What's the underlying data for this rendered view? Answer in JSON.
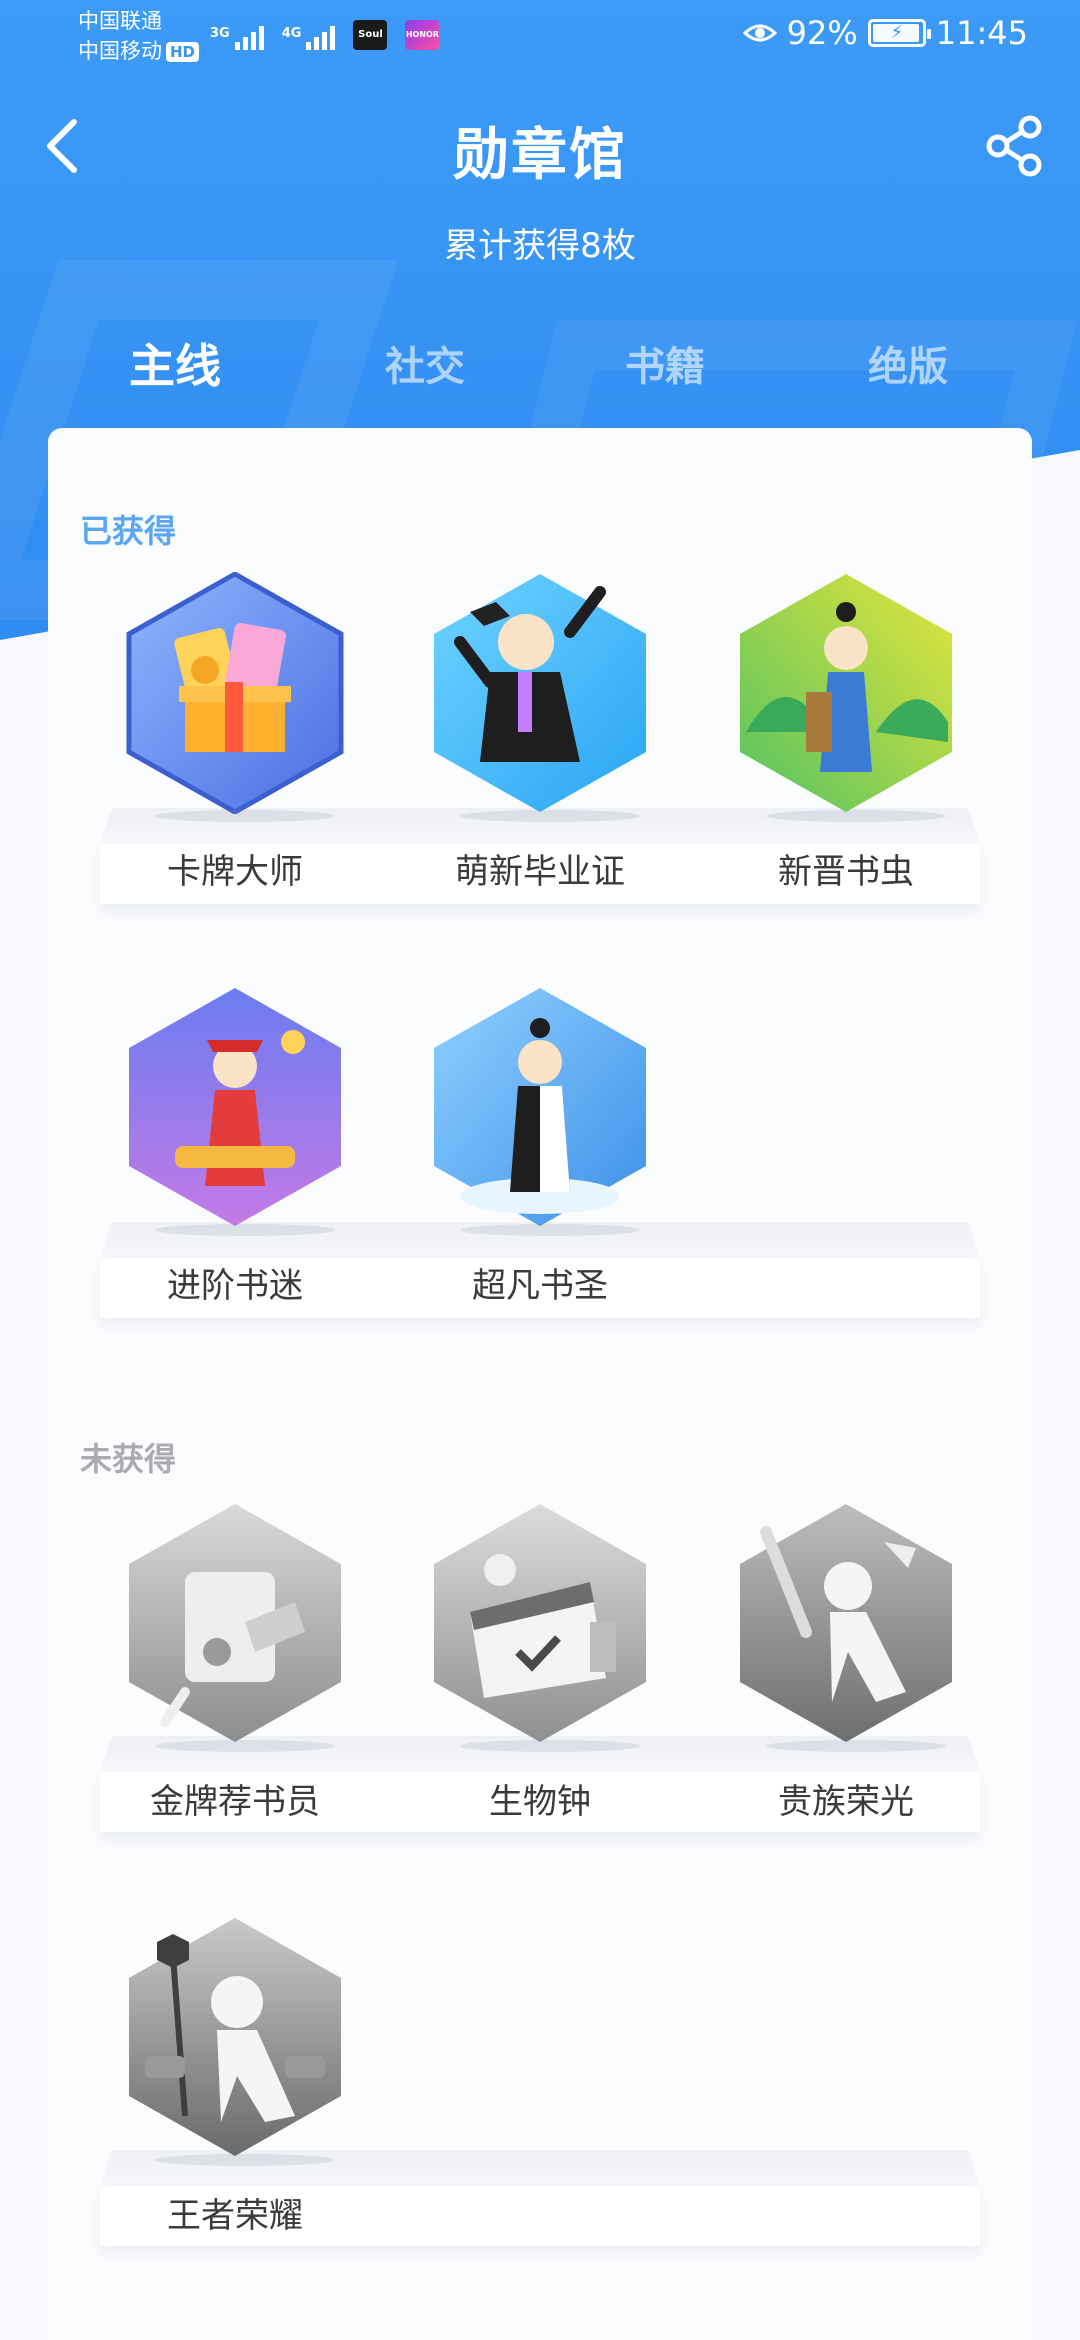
{
  "status_bar": {
    "carrier1": "中国联通",
    "carrier2": "中国移动",
    "hd": "HD",
    "net1": "3G",
    "net2": "4G",
    "app1": "Soul",
    "app2": "HONOR",
    "battery_percent": "92%",
    "time": "11:45"
  },
  "nav": {
    "title": "勋章馆",
    "subtitle": "累计获得8枚"
  },
  "tabs": [
    {
      "label": "主线",
      "active": true
    },
    {
      "label": "社交",
      "active": false
    },
    {
      "label": "书籍",
      "active": false
    },
    {
      "label": "绝版",
      "active": false
    }
  ],
  "sections": {
    "obtained_title": "已获得",
    "not_obtained_title": "未获得"
  },
  "obtained_badges": [
    {
      "name": "卡牌大师",
      "colors": [
        "#4b6fe0",
        "#8fb5ff"
      ]
    },
    {
      "name": "萌新毕业证",
      "colors": [
        "#2aa4f4",
        "#6fd3ff"
      ]
    },
    {
      "name": "新晋书虫",
      "colors": [
        "#52c263",
        "#e6e53a"
      ]
    },
    {
      "name": "进阶书迷",
      "colors": [
        "#7a5ce8",
        "#c37ae6"
      ]
    },
    {
      "name": "超凡书圣",
      "colors": [
        "#3d8fe8",
        "#8fd1ff"
      ]
    }
  ],
  "not_obtained_badges": [
    {
      "name": "金牌荐书员"
    },
    {
      "name": "生物钟"
    },
    {
      "name": "贵族荣光"
    },
    {
      "name": "王者荣耀"
    }
  ],
  "theme": {
    "header_blue": "#3a94f4",
    "obtained_title_color": "#5aa6f2",
    "not_obtained_title_color": "#a9abb1"
  }
}
